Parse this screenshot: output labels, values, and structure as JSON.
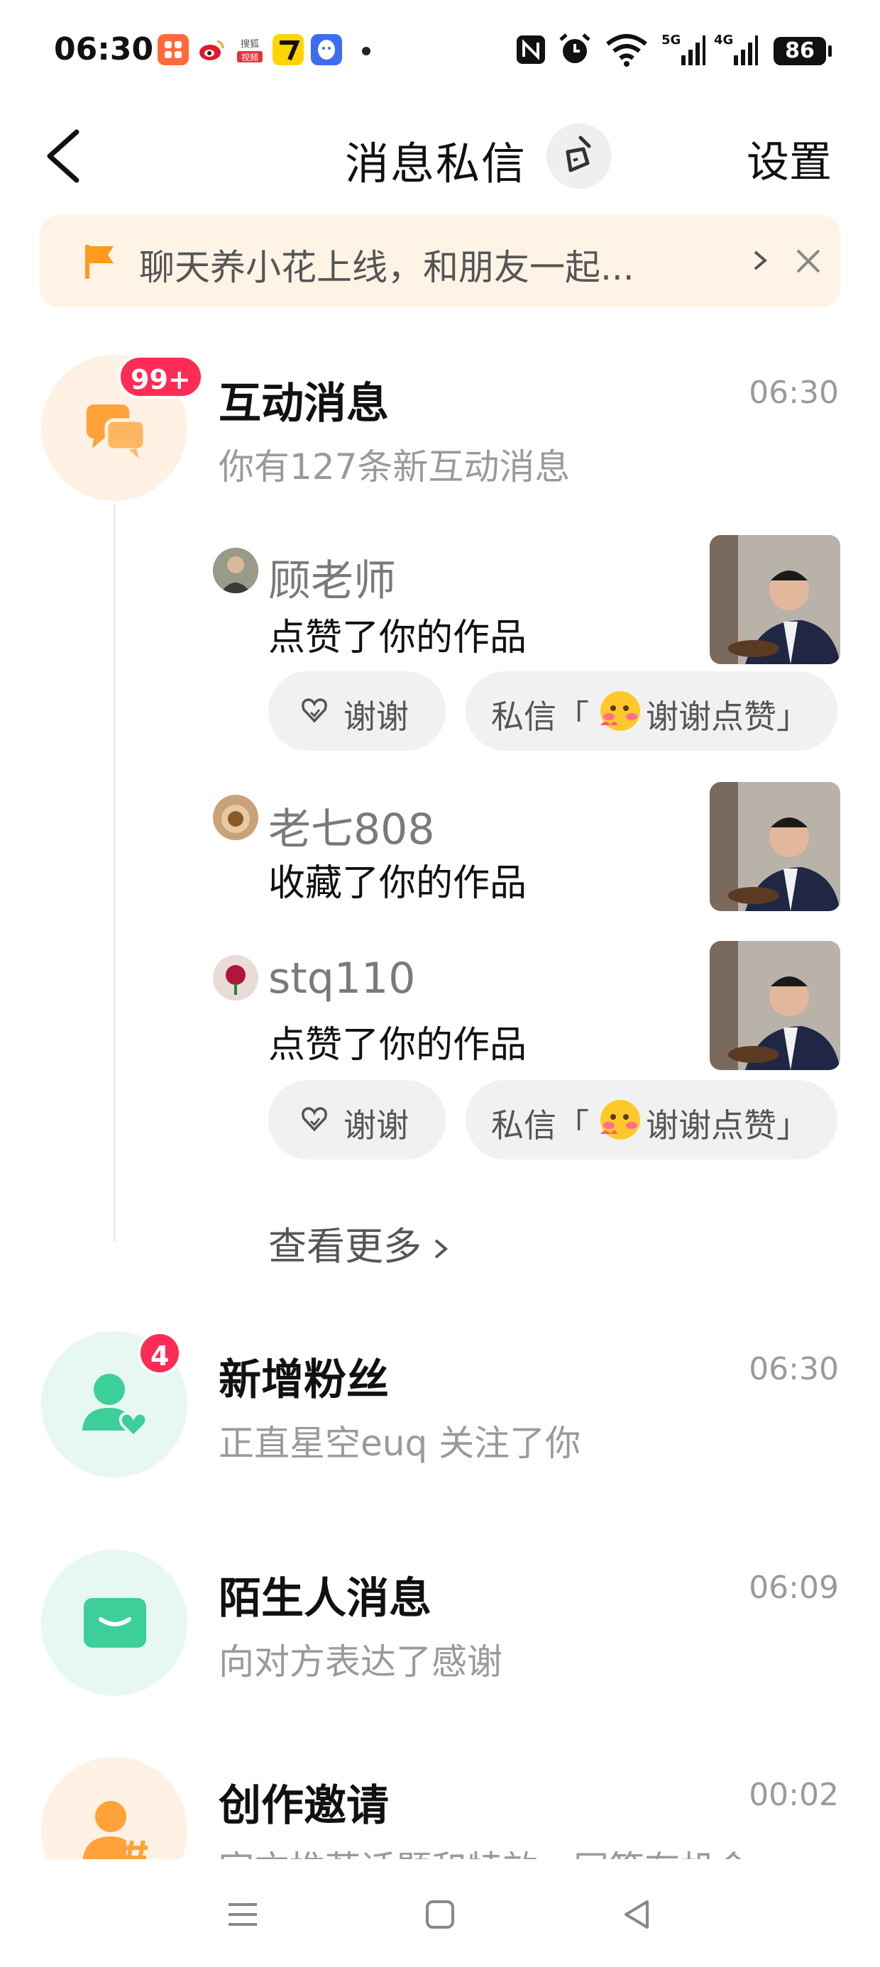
{
  "status_bar": {
    "time": "06:30",
    "battery": "86",
    "app_icons": [
      "xiaohongshu-icon",
      "weibo-icon",
      "sohu-video-icon",
      "qimao-icon",
      "qq-icon"
    ],
    "indicators": [
      "nfc-icon",
      "alarm-icon",
      "wifi-icon",
      "5g-signal-icon",
      "4g-signal-icon"
    ],
    "signal_labels": [
      "5G",
      "4G"
    ],
    "sohu_label": [
      "搜狐",
      "视频"
    ]
  },
  "header": {
    "title": "消息私信",
    "settings_label": "设置"
  },
  "banner": {
    "text": "聊天养小花上线，和朋友一起...",
    "color": "#ff9a1f"
  },
  "interactions": {
    "title": "互动消息",
    "time": "06:30",
    "subtitle": "你有127条新互动消息",
    "badge": "99+",
    "color": "#ffa23a",
    "items": [
      {
        "user": "顾老师",
        "action": "点赞了你的作品",
        "has_actions": true
      },
      {
        "user": "老七808",
        "action": "收藏了你的作品",
        "has_actions": false
      },
      {
        "user": "stq110",
        "action": "点赞了你的作品",
        "has_actions": true
      }
    ],
    "thanks_label": "谢谢",
    "dm_prefix": "私信「",
    "dm_suffix": "谢谢点赞」",
    "see_more": "查看更多"
  },
  "new_fans": {
    "title": "新增粉丝",
    "time": "06:30",
    "subtitle": "正直星空euq 关注了你",
    "badge": "4",
    "color": "#3ccf9a"
  },
  "stranger": {
    "title": "陌生人消息",
    "time": "06:09",
    "subtitle": "向对方表达了感谢",
    "color": "#3ccf9a"
  },
  "creation": {
    "title": "创作邀请",
    "time": "00:02",
    "subtitle": "官方推荐话题和特效，同等有机会",
    "color": "#ff9a1f"
  },
  "nav": {
    "buttons": [
      "menu-icon",
      "home-icon",
      "back-triangle-icon"
    ]
  }
}
